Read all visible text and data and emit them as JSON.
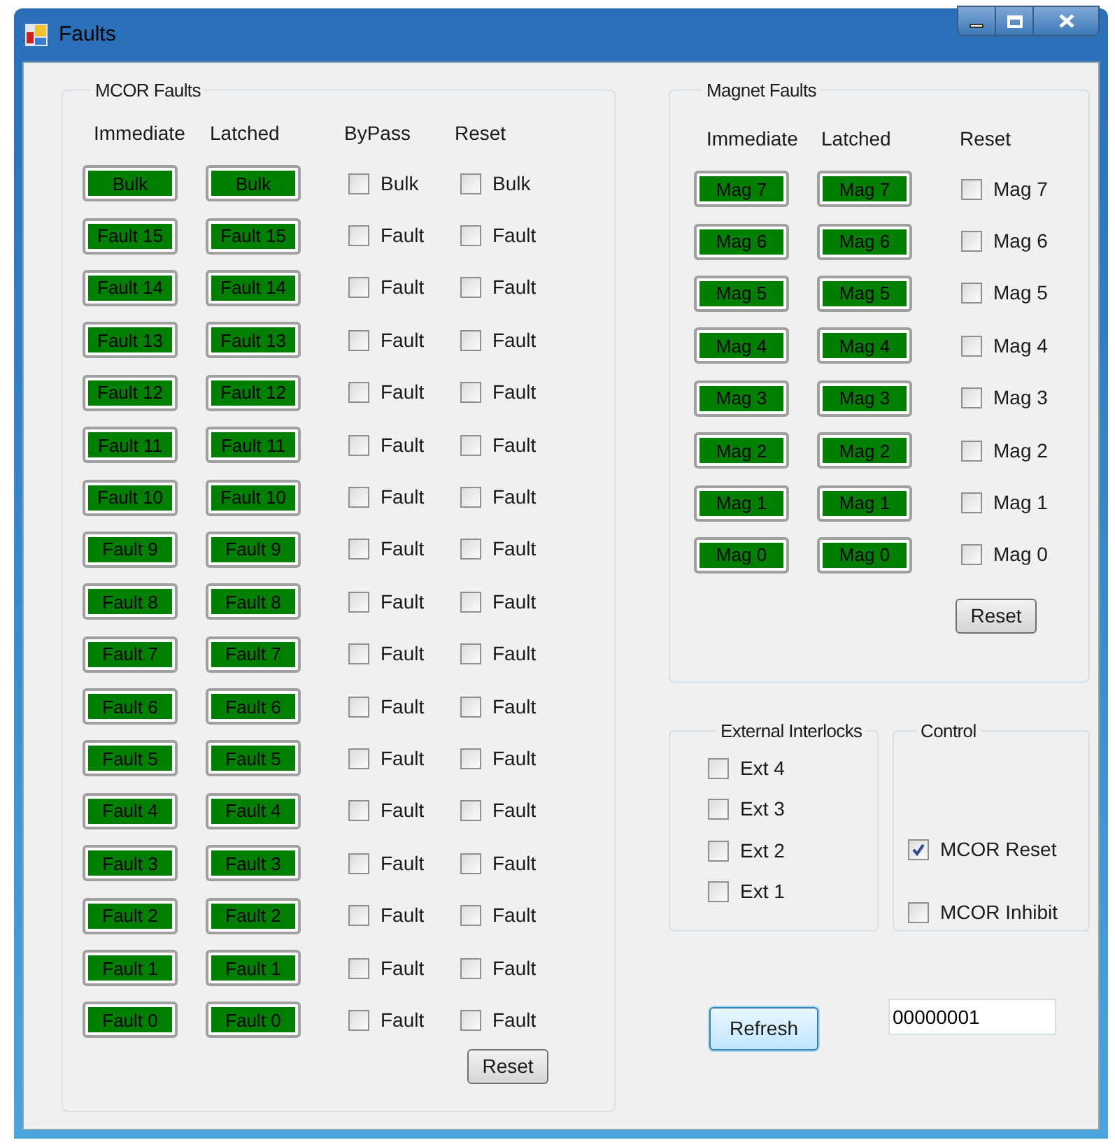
{
  "window": {
    "title": "Faults"
  },
  "mcor_faults": {
    "title": "MCOR Faults",
    "headers": [
      "Immediate",
      "Latched",
      "ByPass",
      "Reset"
    ],
    "rows": [
      {
        "immediate": {
          "label": "Bulk",
          "active": true
        },
        "latched": {
          "label": "Bulk",
          "active": true
        },
        "bypass": {
          "label": "Bulk",
          "checked": false
        },
        "reset": {
          "label": "Bulk",
          "checked": false
        }
      },
      {
        "immediate": {
          "label": "Fault 15",
          "active": true
        },
        "latched": {
          "label": "Fault 15",
          "active": true
        },
        "bypass": {
          "label": "Fault",
          "checked": false
        },
        "reset": {
          "label": "Fault",
          "checked": false
        }
      },
      {
        "immediate": {
          "label": "Fault 14",
          "active": true
        },
        "latched": {
          "label": "Fault 14",
          "active": true
        },
        "bypass": {
          "label": "Fault",
          "checked": false
        },
        "reset": {
          "label": "Fault",
          "checked": false
        }
      },
      {
        "immediate": {
          "label": "Fault 13",
          "active": true
        },
        "latched": {
          "label": "Fault 13",
          "active": true
        },
        "bypass": {
          "label": "Fault",
          "checked": false
        },
        "reset": {
          "label": "Fault",
          "checked": false
        }
      },
      {
        "immediate": {
          "label": "Fault 12",
          "active": true
        },
        "latched": {
          "label": "Fault 12",
          "active": true
        },
        "bypass": {
          "label": "Fault",
          "checked": false
        },
        "reset": {
          "label": "Fault",
          "checked": false
        }
      },
      {
        "immediate": {
          "label": "Fault 11",
          "active": true
        },
        "latched": {
          "label": "Fault 11",
          "active": true
        },
        "bypass": {
          "label": "Fault",
          "checked": false
        },
        "reset": {
          "label": "Fault",
          "checked": false
        }
      },
      {
        "immediate": {
          "label": "Fault 10",
          "active": true
        },
        "latched": {
          "label": "Fault 10",
          "active": true
        },
        "bypass": {
          "label": "Fault",
          "checked": false
        },
        "reset": {
          "label": "Fault",
          "checked": false
        }
      },
      {
        "immediate": {
          "label": "Fault 9",
          "active": true
        },
        "latched": {
          "label": "Fault 9",
          "active": true
        },
        "bypass": {
          "label": "Fault",
          "checked": false
        },
        "reset": {
          "label": "Fault",
          "checked": false
        }
      },
      {
        "immediate": {
          "label": "Fault 8",
          "active": true
        },
        "latched": {
          "label": "Fault 8",
          "active": true
        },
        "bypass": {
          "label": "Fault",
          "checked": false
        },
        "reset": {
          "label": "Fault",
          "checked": false
        }
      },
      {
        "immediate": {
          "label": "Fault 7",
          "active": true
        },
        "latched": {
          "label": "Fault 7",
          "active": true
        },
        "bypass": {
          "label": "Fault",
          "checked": false
        },
        "reset": {
          "label": "Fault",
          "checked": false
        }
      },
      {
        "immediate": {
          "label": "Fault 6",
          "active": true
        },
        "latched": {
          "label": "Fault 6",
          "active": true
        },
        "bypass": {
          "label": "Fault",
          "checked": false
        },
        "reset": {
          "label": "Fault",
          "checked": false
        }
      },
      {
        "immediate": {
          "label": "Fault 5",
          "active": true
        },
        "latched": {
          "label": "Fault 5",
          "active": true
        },
        "bypass": {
          "label": "Fault",
          "checked": false
        },
        "reset": {
          "label": "Fault",
          "checked": false
        }
      },
      {
        "immediate": {
          "label": "Fault 4",
          "active": true
        },
        "latched": {
          "label": "Fault 4",
          "active": true
        },
        "bypass": {
          "label": "Fault",
          "checked": false
        },
        "reset": {
          "label": "Fault",
          "checked": false
        }
      },
      {
        "immediate": {
          "label": "Fault 3",
          "active": true
        },
        "latched": {
          "label": "Fault 3",
          "active": true
        },
        "bypass": {
          "label": "Fault",
          "checked": false
        },
        "reset": {
          "label": "Fault",
          "checked": false
        }
      },
      {
        "immediate": {
          "label": "Fault 2",
          "active": true
        },
        "latched": {
          "label": "Fault 2",
          "active": true
        },
        "bypass": {
          "label": "Fault",
          "checked": false
        },
        "reset": {
          "label": "Fault",
          "checked": false
        }
      },
      {
        "immediate": {
          "label": "Fault 1",
          "active": true
        },
        "latched": {
          "label": "Fault 1",
          "active": true
        },
        "bypass": {
          "label": "Fault",
          "checked": false
        },
        "reset": {
          "label": "Fault",
          "checked": false
        }
      },
      {
        "immediate": {
          "label": "Fault 0",
          "active": true
        },
        "latched": {
          "label": "Fault 0",
          "active": true
        },
        "bypass": {
          "label": "Fault",
          "checked": false
        },
        "reset": {
          "label": "Fault",
          "checked": false
        }
      }
    ],
    "reset_button": "Reset"
  },
  "magnet_faults": {
    "title": "Magnet Faults",
    "headers": [
      "Immediate",
      "Latched",
      "Reset"
    ],
    "rows": [
      {
        "immediate": {
          "label": "Mag 7",
          "active": true
        },
        "latched": {
          "label": "Mag 7",
          "active": true
        },
        "reset": {
          "label": "Mag 7",
          "checked": false
        }
      },
      {
        "immediate": {
          "label": "Mag 6",
          "active": true
        },
        "latched": {
          "label": "Mag 6",
          "active": true
        },
        "reset": {
          "label": "Mag 6",
          "checked": false
        }
      },
      {
        "immediate": {
          "label": "Mag 5",
          "active": true
        },
        "latched": {
          "label": "Mag 5",
          "active": true
        },
        "reset": {
          "label": "Mag 5",
          "checked": false
        }
      },
      {
        "immediate": {
          "label": "Mag 4",
          "active": true
        },
        "latched": {
          "label": "Mag 4",
          "active": true
        },
        "reset": {
          "label": "Mag 4",
          "checked": false
        }
      },
      {
        "immediate": {
          "label": "Mag 3",
          "active": true
        },
        "latched": {
          "label": "Mag 3",
          "active": true
        },
        "reset": {
          "label": "Mag 3",
          "checked": false
        }
      },
      {
        "immediate": {
          "label": "Mag 2",
          "active": true
        },
        "latched": {
          "label": "Mag 2",
          "active": true
        },
        "reset": {
          "label": "Mag 2",
          "checked": false
        }
      },
      {
        "immediate": {
          "label": "Mag 1",
          "active": true
        },
        "latched": {
          "label": "Mag 1",
          "active": true
        },
        "reset": {
          "label": "Mag 1",
          "checked": false
        }
      },
      {
        "immediate": {
          "label": "Mag 0",
          "active": true
        },
        "latched": {
          "label": "Mag 0",
          "active": true
        },
        "reset": {
          "label": "Mag 0",
          "checked": false
        }
      }
    ],
    "reset_button": "Reset"
  },
  "external_interlocks": {
    "title": "External Interlocks",
    "items": [
      {
        "label": "Ext 4",
        "checked": false
      },
      {
        "label": "Ext 3",
        "checked": false
      },
      {
        "label": "Ext 2",
        "checked": false
      },
      {
        "label": "Ext 1",
        "checked": false
      }
    ]
  },
  "control": {
    "title": "Control",
    "items": [
      {
        "label": "MCOR Reset",
        "checked": true
      },
      {
        "label": "MCOR Inhibit",
        "checked": false
      }
    ]
  },
  "refresh_button": "Refresh",
  "value_field": {
    "value": "00000001"
  }
}
